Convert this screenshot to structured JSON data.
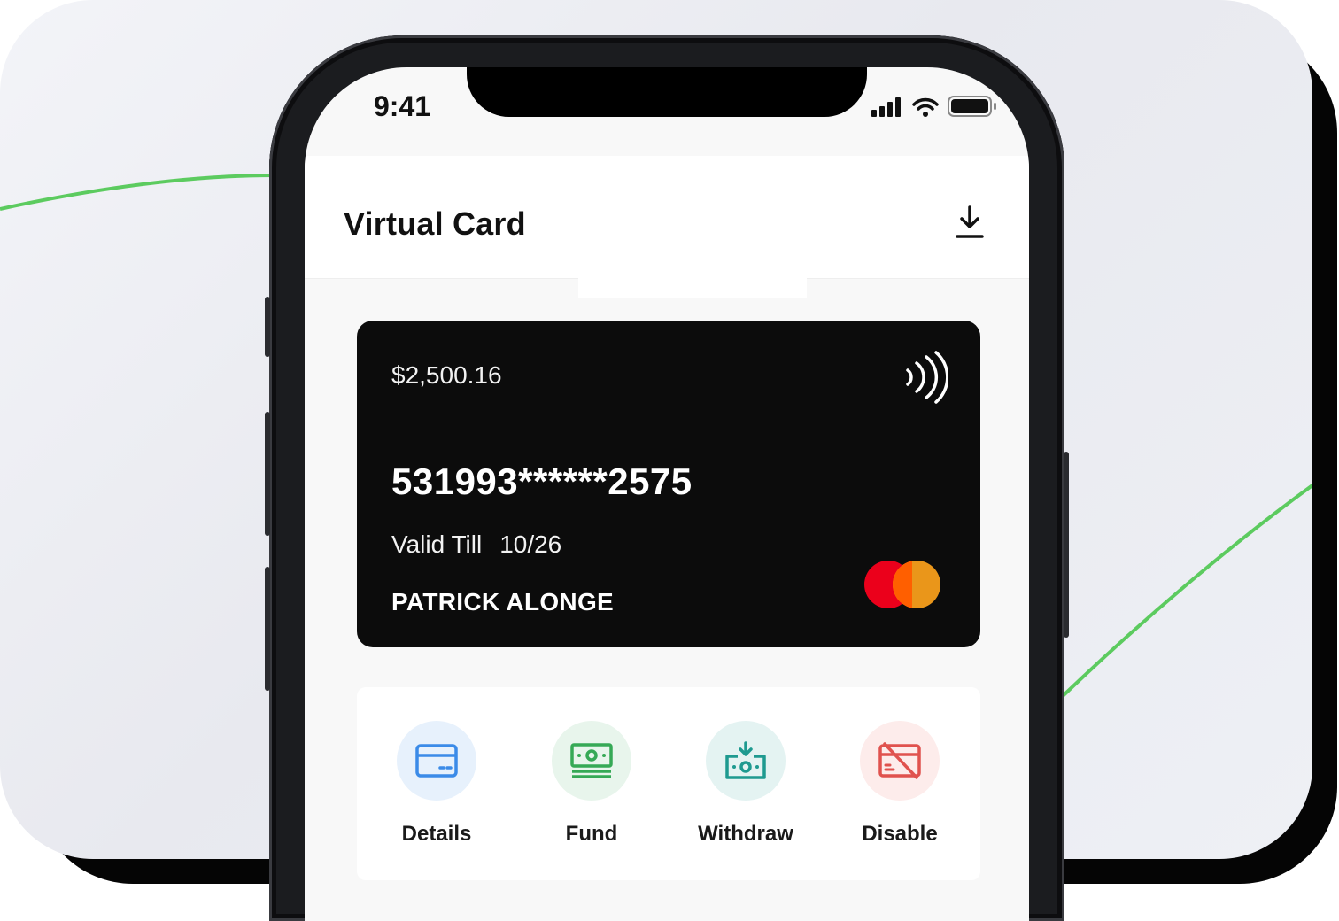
{
  "status_bar": {
    "time": "9:41"
  },
  "header": {
    "title": "Virtual Card",
    "download_icon": "download-icon"
  },
  "card": {
    "balance": "$2,500.16",
    "number": "531993******2575",
    "valid_label": "Valid Till",
    "valid_value": "10/26",
    "holder": "PATRICK ALONGE",
    "background_color": "#0c0c0c",
    "network_icon": "mastercard-logo",
    "contactless_icon": "contactless-icon"
  },
  "actions": [
    {
      "label": "Details",
      "icon": "card-icon",
      "color": "#3b8be8",
      "bg": "#e7f1fc"
    },
    {
      "label": "Fund",
      "icon": "cash-icon",
      "color": "#36a956",
      "bg": "#e8f5ec"
    },
    {
      "label": "Withdraw",
      "icon": "withdraw-icon",
      "color": "#1e9a90",
      "bg": "#e4f3f2"
    },
    {
      "label": "Disable",
      "icon": "card-off-icon",
      "color": "#e0524e",
      "bg": "#fdeceb"
    }
  ],
  "accent_colors": {
    "curve": "#5ccb5f",
    "mastercard_red": "#eb001b",
    "mastercard_orange": "#f79e1b"
  }
}
